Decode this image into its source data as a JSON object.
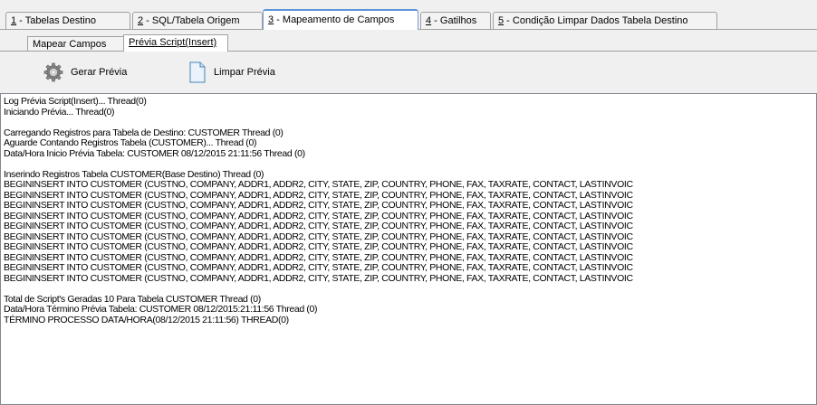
{
  "tabs": [
    {
      "key": "1",
      "label": " - Tabelas Destino"
    },
    {
      "key": "2",
      "label": " - SQL/Tabela Origem"
    },
    {
      "key": "3",
      "label": " - Mapeamento de Campos"
    },
    {
      "key": "4",
      "label": " - Gatilhos"
    },
    {
      "key": "5",
      "label": " - Condição Limpar Dados Tabela Destino"
    }
  ],
  "subtabs": [
    {
      "label": "Mapear Campos"
    },
    {
      "label": "Prévia Script(Insert)"
    }
  ],
  "toolbar": {
    "generate_label": "Gerar Prévia",
    "clear_label": "Limpar Prévia"
  },
  "log": {
    "lines": [
      "Log Prévia Script(Insert)... Thread(0)",
      "Iniciando Prévia... Thread(0)",
      "",
      "Carregando Registros para Tabela de Destino: CUSTOMER Thread (0)",
      "Aguarde Contando Registros Tabela (CUSTOMER)... Thread (0)",
      "Data/Hora Inicio Prévia Tabela: CUSTOMER 08/12/2015 21:11:56 Thread (0)",
      "",
      "Inserindo Registros Tabela CUSTOMER(Base Destino) Thread (0)",
      "BEGININSERT INTO CUSTOMER (CUSTNO, COMPANY, ADDR1, ADDR2, CITY, STATE, ZIP, COUNTRY, PHONE, FAX, TAXRATE, CONTACT, LASTINVOIC",
      "BEGININSERT INTO CUSTOMER (CUSTNO, COMPANY, ADDR1, ADDR2, CITY, STATE, ZIP, COUNTRY, PHONE, FAX, TAXRATE, CONTACT, LASTINVOIC",
      "BEGININSERT INTO CUSTOMER (CUSTNO, COMPANY, ADDR1, ADDR2, CITY, STATE, ZIP, COUNTRY, PHONE, FAX, TAXRATE, CONTACT, LASTINVOIC",
      "BEGININSERT INTO CUSTOMER (CUSTNO, COMPANY, ADDR1, ADDR2, CITY, STATE, ZIP, COUNTRY, PHONE, FAX, TAXRATE, CONTACT, LASTINVOIC",
      "BEGININSERT INTO CUSTOMER (CUSTNO, COMPANY, ADDR1, ADDR2, CITY, STATE, ZIP, COUNTRY, PHONE, FAX, TAXRATE, CONTACT, LASTINVOIC",
      "BEGININSERT INTO CUSTOMER (CUSTNO, COMPANY, ADDR1, ADDR2, CITY, STATE, ZIP, COUNTRY, PHONE, FAX, TAXRATE, CONTACT, LASTINVOIC",
      "BEGININSERT INTO CUSTOMER (CUSTNO, COMPANY, ADDR1, ADDR2, CITY, STATE, ZIP, COUNTRY, PHONE, FAX, TAXRATE, CONTACT, LASTINVOIC",
      "BEGININSERT INTO CUSTOMER (CUSTNO, COMPANY, ADDR1, ADDR2, CITY, STATE, ZIP, COUNTRY, PHONE, FAX, TAXRATE, CONTACT, LASTINVOIC",
      "BEGININSERT INTO CUSTOMER (CUSTNO, COMPANY, ADDR1, ADDR2, CITY, STATE, ZIP, COUNTRY, PHONE, FAX, TAXRATE, CONTACT, LASTINVOIC",
      "BEGININSERT INTO CUSTOMER (CUSTNO, COMPANY, ADDR1, ADDR2, CITY, STATE, ZIP, COUNTRY, PHONE, FAX, TAXRATE, CONTACT, LASTINVOIC",
      "",
      "Total de Script's Geradas 10 Para Tabela CUSTOMER Thread (0)",
      "Data/Hora Término Prévia Tabela: CUSTOMER 08/12/2015:21:11:56 Thread (0)",
      "TÉRMINO PROCESSO DATA/HORA(08/12/2015 21:11:56) THREAD(0)"
    ]
  },
  "colors": {
    "active_tab_accent": "#5f94d8",
    "log_background": "#ffffff",
    "window_background": "#f0f0f0"
  },
  "icons": {
    "generate": "gear-icon",
    "clear": "document-icon"
  }
}
